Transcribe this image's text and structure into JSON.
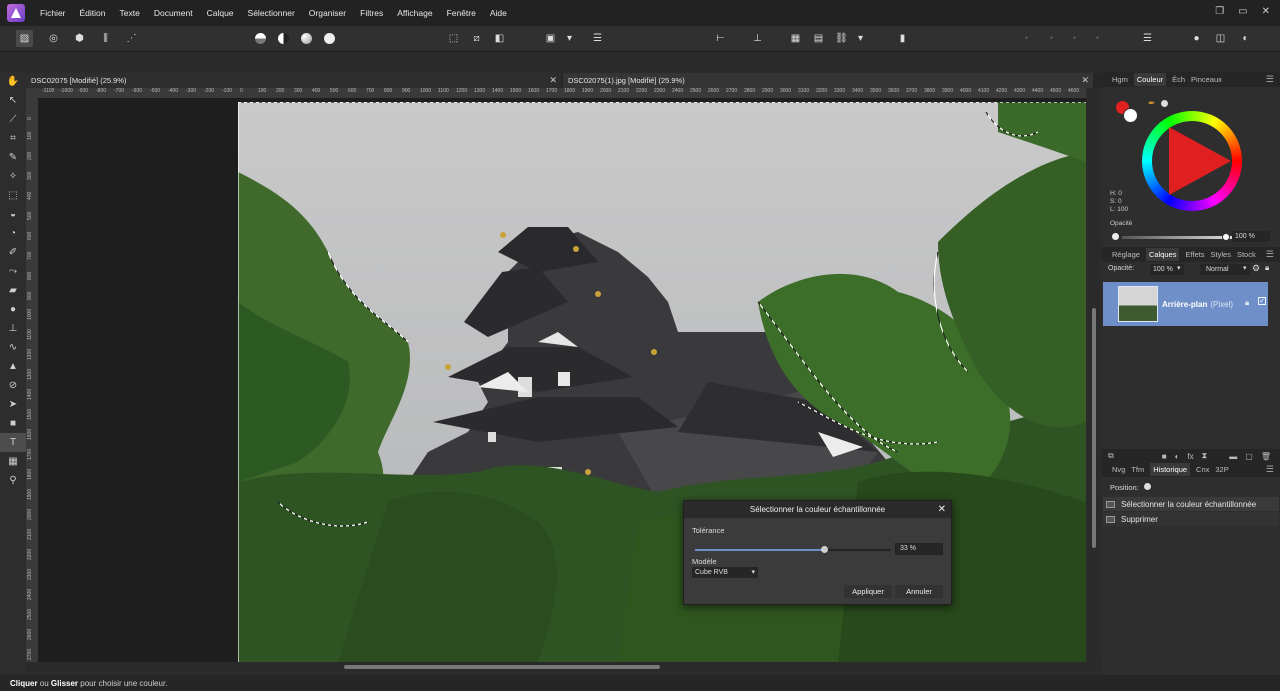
{
  "menu": [
    "Fichier",
    "Édition",
    "Texte",
    "Document",
    "Calque",
    "Sélectionner",
    "Organiser",
    "Filtres",
    "Affichage",
    "Fenêtre",
    "Aide"
  ],
  "window_controls": [
    "❐",
    "▭",
    "✕"
  ],
  "documents": [
    {
      "title": "DSC02075 [Modifié] (25.9%)"
    },
    {
      "title": "DSC02075(1).jpg [Modifié] (25.9%)"
    }
  ],
  "ruler_h_ticks": [
    "-1100",
    "-1000",
    "-900",
    "-800",
    "-700",
    "-600",
    "-500",
    "-400",
    "-300",
    "-200",
    "-100",
    "0",
    "100",
    "200",
    "300",
    "400",
    "500",
    "600",
    "700",
    "800",
    "900",
    "1000",
    "1100",
    "1200",
    "1300",
    "1400",
    "1500",
    "1600",
    "1700",
    "1800",
    "1900",
    "2000",
    "2100",
    "2200",
    "2300",
    "2400",
    "2500",
    "2600",
    "2700",
    "2800",
    "2900",
    "3000",
    "3100",
    "3200",
    "3300",
    "3400",
    "3500",
    "3600",
    "3700",
    "3800",
    "3900",
    "4000",
    "4100",
    "4200",
    "4300",
    "4400",
    "4500",
    "4600"
  ],
  "ruler_v_ticks": [
    "0",
    "100",
    "200",
    "300",
    "400",
    "500",
    "600",
    "700",
    "800",
    "900",
    "1000",
    "1100",
    "1200",
    "1300",
    "1400",
    "1500",
    "1600",
    "1700",
    "1800",
    "1900",
    "2000",
    "2100",
    "2200",
    "2300",
    "2400",
    "2500",
    "2600",
    "2700"
  ],
  "color_panel": {
    "tabs": [
      "Hgm",
      "Couleur",
      "Éch",
      "Pinceaux"
    ],
    "active_tab": "Couleur",
    "h": "H: 0",
    "s": "S: 0",
    "l": "L: 100",
    "opacity_label": "Opacité",
    "opacity_value": "100 %",
    "primary_color": "#e02020",
    "secondary_color": "#ffffff"
  },
  "layers_panel": {
    "tabs": [
      "Réglage",
      "Calques",
      "Effets",
      "Styles",
      "Stock"
    ],
    "active_tab": "Calques",
    "opacity_label": "Opacité:",
    "opacity_value": "100 %",
    "blend_mode": "Normal",
    "layer_name": "Arrière-plan",
    "layer_type": "(Pixel)"
  },
  "history_panel": {
    "tabs": [
      "Nvg",
      "Tfm",
      "Historique",
      "Cnx",
      "32P"
    ],
    "active_tab": "Historique",
    "position_label": "Position:",
    "items": [
      "Sélectionner la couleur échantillonnée",
      "Supprimer"
    ]
  },
  "dialog": {
    "title": "Sélectionner la couleur échantillonnée",
    "tolerance_label": "Tolérance",
    "tolerance_value": "33 %",
    "tolerance_fraction": 0.33,
    "model_label": "Modèle",
    "model_value": "Cube RVB",
    "apply_label": "Appliquer",
    "cancel_label": "Annuler"
  },
  "status": {
    "bold1": "Cliquer",
    "text1": " ou ",
    "bold2": "Glisser",
    "text2": " pour choisir une couleur."
  },
  "accent_color": "#6f8fc8"
}
